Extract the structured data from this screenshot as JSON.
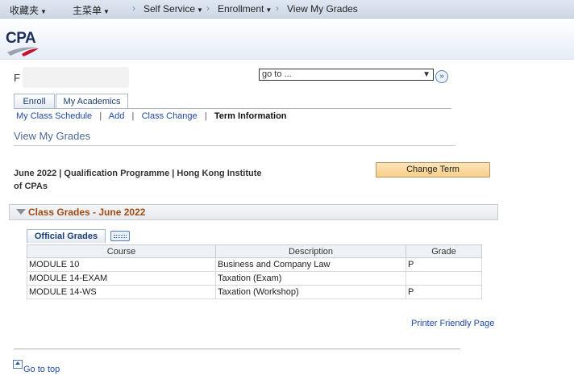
{
  "topnav": {
    "favorites": "收藏夹",
    "main_menu": "主菜单",
    "breadcrumb": [
      "Self Service",
      "Enrollment",
      "View My Grades"
    ]
  },
  "logo": {
    "text": "CPA"
  },
  "user": {
    "initial": "F"
  },
  "goto": {
    "value": "go to ...",
    "button_icon": "double-chevron-right-icon"
  },
  "tabs": [
    "Enroll",
    "My Academics"
  ],
  "subnav": [
    "My Class Schedule",
    "Add",
    "Class Change",
    "Term Information"
  ],
  "page_title": "View My Grades",
  "term": {
    "line1": "June 2022 | Qualification Programme | Hong Kong Institute",
    "line2": "of CPAs"
  },
  "change_term": "Change Term",
  "group": {
    "title": "Class Grades - June 2022"
  },
  "grid_tab": "Official Grades",
  "columns": [
    "Course",
    "Description",
    "Grade"
  ],
  "rows": [
    [
      "MODULE 10",
      "Business and Company Law",
      "P"
    ],
    [
      "MODULE 14-EXAM",
      "Taxation (Exam)",
      ""
    ],
    [
      "MODULE 14-WS",
      "Taxation (Workshop)",
      "P"
    ]
  ],
  "printer": "Printer Friendly Page",
  "go_top": "Go to top",
  "colors": {
    "accent_blue": "#1f4aa8",
    "group_title": "#a34a14",
    "button": "#f7cf89"
  }
}
